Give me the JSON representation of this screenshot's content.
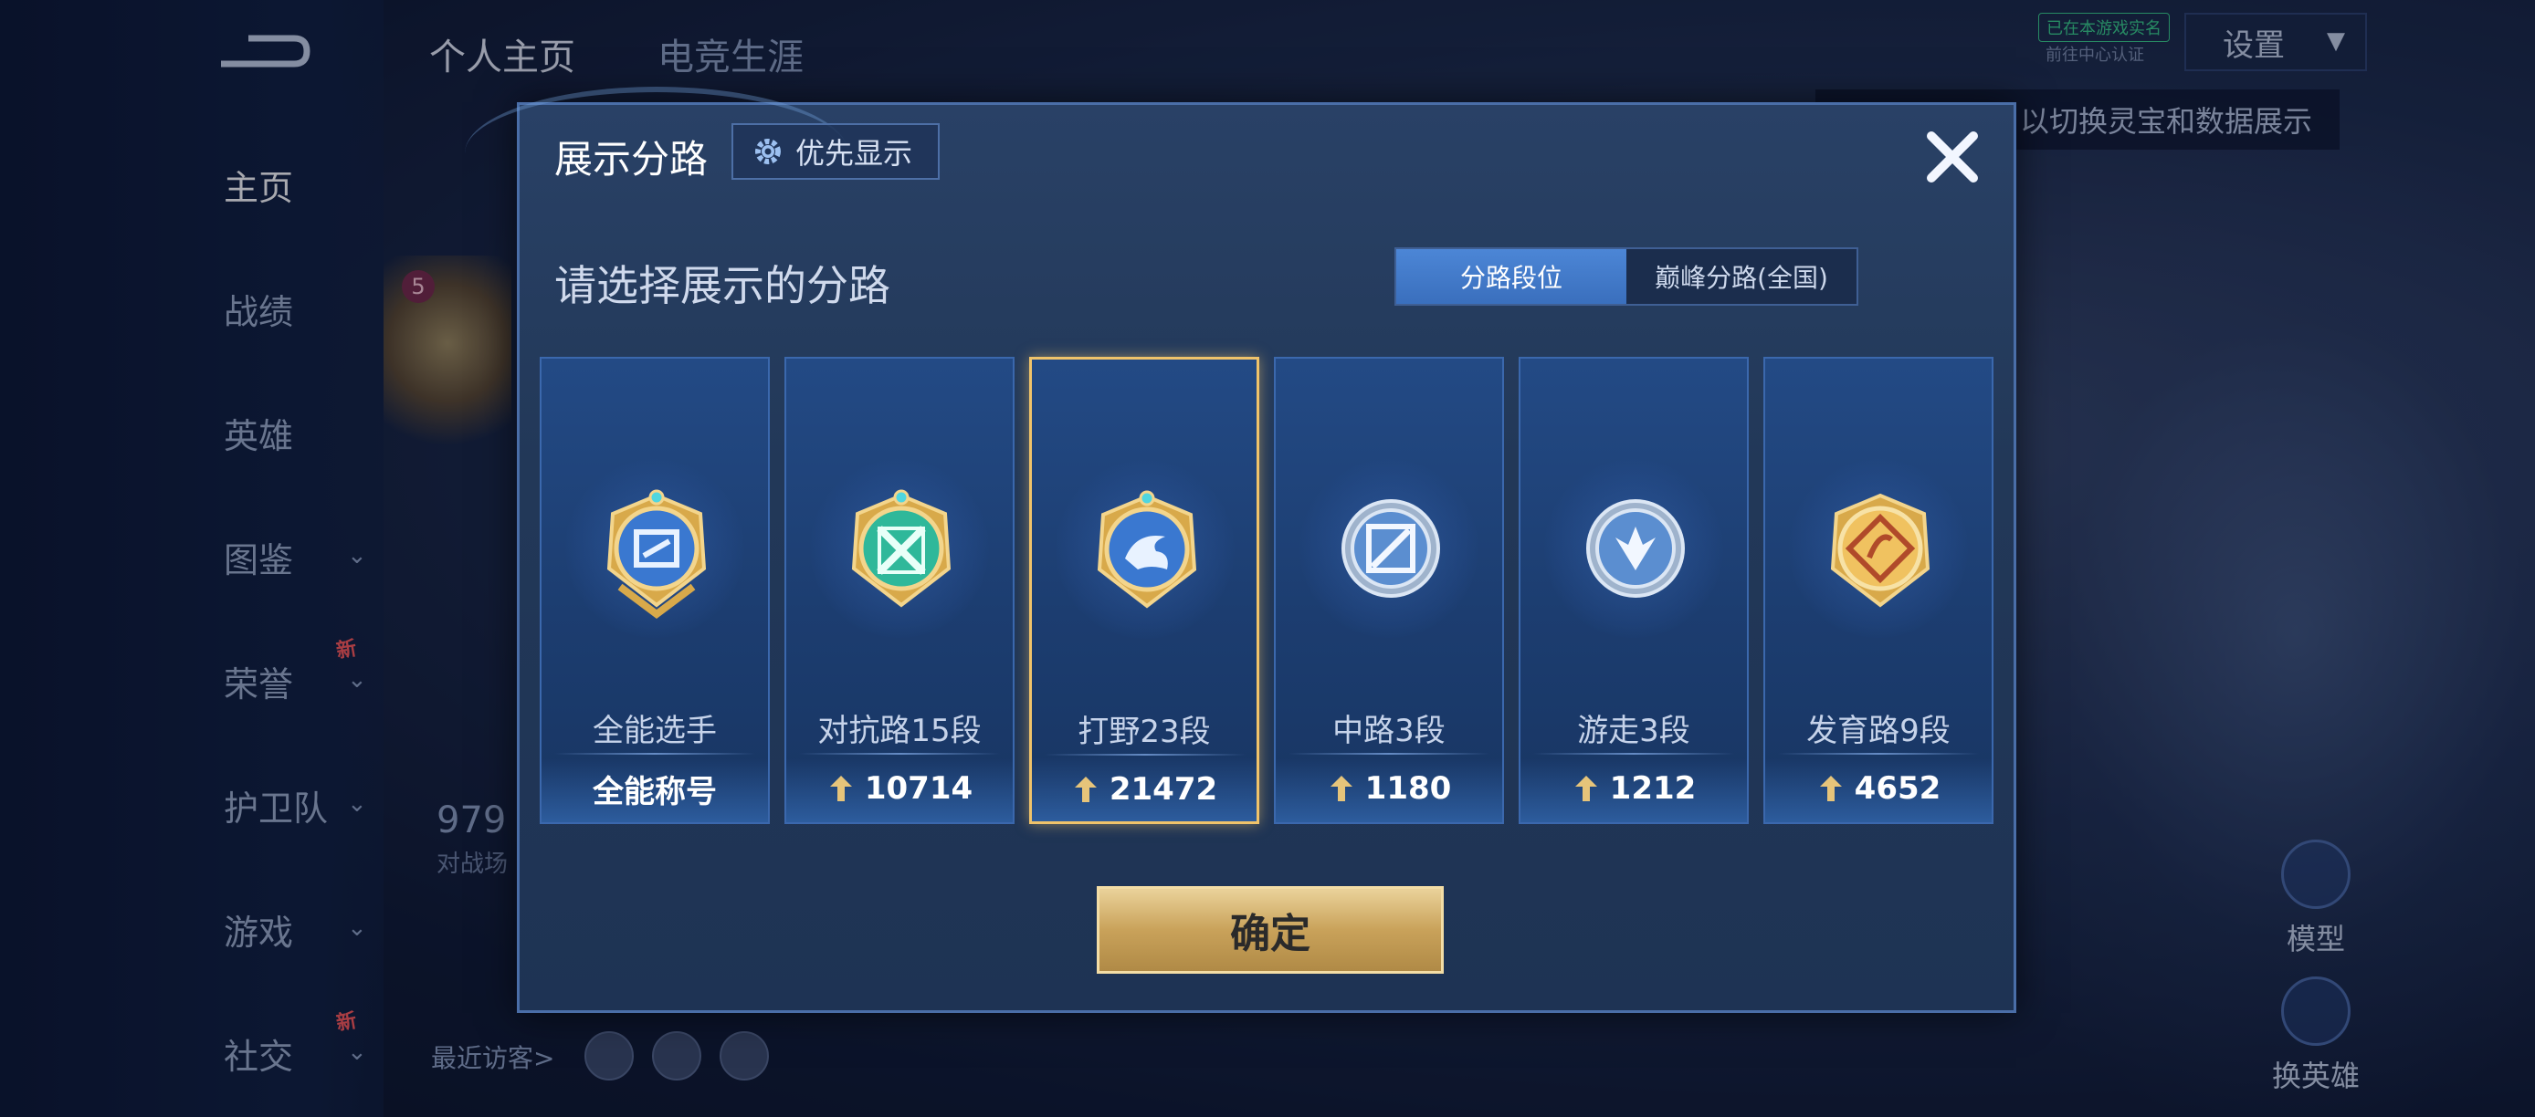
{
  "sidebar": {
    "items": [
      {
        "label": "主页",
        "active": true
      },
      {
        "label": "战绩"
      },
      {
        "label": "英雄"
      },
      {
        "label": "图鉴"
      },
      {
        "label": "荣誉",
        "badge": "新"
      },
      {
        "label": "护卫队"
      },
      {
        "label": "游戏"
      },
      {
        "label": "社交",
        "badge": "新"
      }
    ]
  },
  "top_tabs": [
    "个人主页",
    "电竞生涯"
  ],
  "settings": {
    "label": "设置"
  },
  "realname": {
    "tag": "已在本游戏实名",
    "sub": "前往中心认证"
  },
  "hint_banner": "以切换灵宝和数据展示",
  "profile": {
    "level": "5",
    "stat_value": "979",
    "stat_label": "对战场",
    "visitors_label": "最近访客>"
  },
  "right_buttons": [
    "模型",
    "换英雄"
  ],
  "dialog": {
    "title": "展示分路",
    "priority_label": "优先显示",
    "subtitle": "请选择展示的分路",
    "segments": [
      "分路段位",
      "巅峰分路(全国)"
    ],
    "active_segment": 0,
    "confirm_label": "确定",
    "cards": [
      {
        "name": "全能选手",
        "value": "全能称号",
        "selected": false,
        "emblem": "all-rounder-emblem-icon",
        "has_score_icon": false
      },
      {
        "name": "对抗路15段",
        "value": "10714",
        "selected": false,
        "emblem": "clash-lane-emblem-icon",
        "has_score_icon": true
      },
      {
        "name": "打野23段",
        "value": "21472",
        "selected": true,
        "emblem": "jungle-emblem-icon",
        "has_score_icon": true
      },
      {
        "name": "中路3段",
        "value": "1180",
        "selected": false,
        "emblem": "mid-lane-emblem-icon",
        "has_score_icon": true
      },
      {
        "name": "游走3段",
        "value": "1212",
        "selected": false,
        "emblem": "roam-emblem-icon",
        "has_score_icon": true
      },
      {
        "name": "发育路9段",
        "value": "4652",
        "selected": false,
        "emblem": "farm-lane-emblem-icon",
        "has_score_icon": true
      }
    ]
  },
  "colors": {
    "accent_blue": "#3a6fbd",
    "gold": "#c9a25a",
    "selected_border": "#f0c36a"
  }
}
